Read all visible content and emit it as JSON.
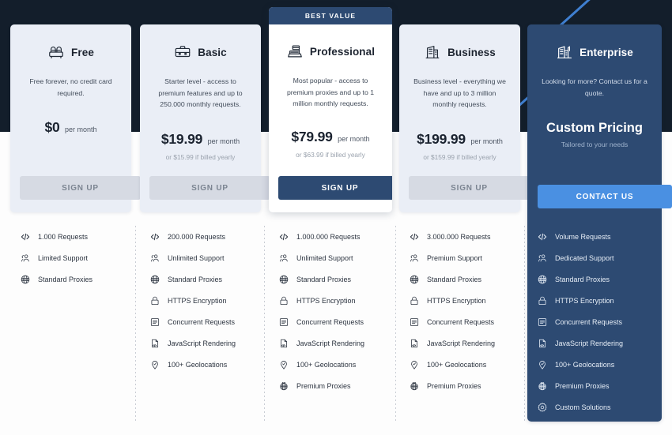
{
  "theme": {
    "dark_band": "#131e2b",
    "card_bg": "#eaeef6",
    "featured_card_bg": "#ffffff",
    "accent_navy": "#2d4a72",
    "accent_blue": "#4a90e2",
    "muted_button": "#d6dae3",
    "diagonal_line": "#3f7fd0"
  },
  "featured": {
    "badge_label": "BEST VALUE"
  },
  "plans": [
    {
      "id": "free",
      "name": "Free",
      "icon": "armchair-icon",
      "description": "Free forever,\nno credit card required.",
      "price": "$0",
      "period": "per month",
      "yearly_note": "",
      "cta_label": "SIGN UP",
      "cta_style": "muted",
      "features": [
        {
          "icon": "code-icon",
          "label": "1.000 Requests"
        },
        {
          "icon": "people-icon",
          "label": "Limited Support"
        },
        {
          "icon": "globe-icon",
          "label": "Standard Proxies"
        }
      ]
    },
    {
      "id": "basic",
      "name": "Basic",
      "icon": "briefcase-icon",
      "description": "Starter level - access to premium features and up to 250.000 monthly requests.",
      "price": "$19.99",
      "period": "per month",
      "yearly_note": "or $15.99 if billed yearly",
      "cta_label": "SIGN UP",
      "cta_style": "muted",
      "features": [
        {
          "icon": "code-icon",
          "label": "200.000 Requests"
        },
        {
          "icon": "people-icon",
          "label": "Unlimited Support"
        },
        {
          "icon": "globe-icon",
          "label": "Standard Proxies"
        },
        {
          "icon": "lock-icon",
          "label": "HTTPS Encryption"
        },
        {
          "icon": "list-icon",
          "label": "Concurrent Requests"
        },
        {
          "icon": "document-code-icon",
          "label": "JavaScript Rendering"
        },
        {
          "icon": "location-pin-icon",
          "label": "100+ Geolocations"
        }
      ]
    },
    {
      "id": "professional",
      "name": "Professional",
      "icon": "cash-register-icon",
      "description": "Most popular - access to premium proxies and up to 1 million monthly requests.",
      "price": "$79.99",
      "period": "per month",
      "yearly_note": "or $63.99 if billed yearly",
      "cta_label": "SIGN UP",
      "cta_style": "primary",
      "features": [
        {
          "icon": "code-icon",
          "label": "1.000.000 Requests"
        },
        {
          "icon": "people-icon",
          "label": "Unlimited Support"
        },
        {
          "icon": "globe-icon",
          "label": "Standard Proxies"
        },
        {
          "icon": "lock-icon",
          "label": "HTTPS Encryption"
        },
        {
          "icon": "list-icon",
          "label": "Concurrent Requests"
        },
        {
          "icon": "document-code-icon",
          "label": "JavaScript Rendering"
        },
        {
          "icon": "location-pin-icon",
          "label": "100+ Geolocations"
        },
        {
          "icon": "premium-globe-icon",
          "label": "Premium Proxies"
        }
      ]
    },
    {
      "id": "business",
      "name": "Business",
      "icon": "office-building-icon",
      "description": "Business level - everything we have and up to 3 million monthly requests.",
      "price": "$199.99",
      "period": "per month",
      "yearly_note": "or $159.99 if billed yearly",
      "cta_label": "SIGN UP",
      "cta_style": "muted",
      "features": [
        {
          "icon": "code-icon",
          "label": "3.000.000 Requests"
        },
        {
          "icon": "people-icon",
          "label": "Premium Support"
        },
        {
          "icon": "globe-icon",
          "label": "Standard Proxies"
        },
        {
          "icon": "lock-icon",
          "label": "HTTPS Encryption"
        },
        {
          "icon": "list-icon",
          "label": "Concurrent Requests"
        },
        {
          "icon": "document-code-icon",
          "label": "JavaScript Rendering"
        },
        {
          "icon": "location-pin-icon",
          "label": "100+ Geolocations"
        },
        {
          "icon": "premium-globe-icon",
          "label": "Premium Proxies"
        }
      ]
    },
    {
      "id": "enterprise",
      "name": "Enterprise",
      "icon": "enterprise-building-icon",
      "description": "Looking for more?\nContact us for a quote.",
      "price": "Custom Pricing",
      "period": "",
      "yearly_note": "Tailored to your needs",
      "cta_label": "CONTACT US",
      "cta_style": "accent",
      "features": [
        {
          "icon": "code-icon",
          "label": "Volume Requests"
        },
        {
          "icon": "people-icon",
          "label": "Dedicated Support"
        },
        {
          "icon": "globe-icon",
          "label": "Standard Proxies"
        },
        {
          "icon": "lock-icon",
          "label": "HTTPS Encryption"
        },
        {
          "icon": "list-icon",
          "label": "Concurrent Requests"
        },
        {
          "icon": "document-code-icon",
          "label": "JavaScript Rendering"
        },
        {
          "icon": "location-pin-icon",
          "label": "100+ Geolocations"
        },
        {
          "icon": "premium-globe-icon",
          "label": "Premium Proxies"
        },
        {
          "icon": "gear-icon",
          "label": "Custom Solutions"
        }
      ]
    }
  ]
}
